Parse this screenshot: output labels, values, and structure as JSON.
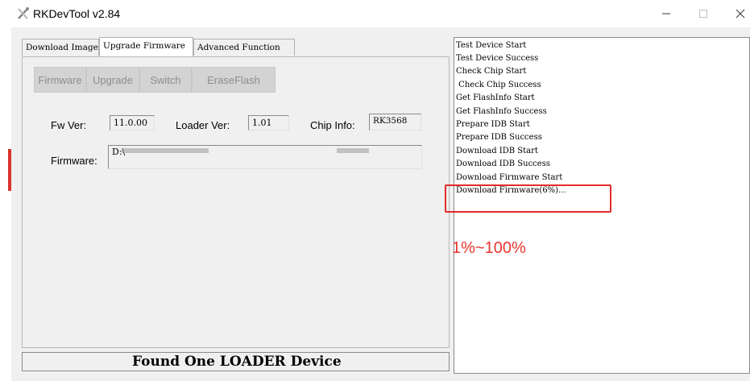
{
  "window": {
    "title": "RKDevTool v2.84"
  },
  "tabs": [
    {
      "label": "Download Image"
    },
    {
      "label": "Upgrade Firmware"
    },
    {
      "label": "Advanced Function"
    }
  ],
  "toolbar": {
    "firmware": "Firmware",
    "upgrade": "Upgrade",
    "switch": "Switch",
    "erase": "EraseFlash"
  },
  "info": {
    "fw_ver_label": "Fw Ver:",
    "fw_ver_value": "11.0.00",
    "loader_ver_label": "Loader Ver:",
    "loader_ver_value": "1.01",
    "chip_info_label": "Chip Info:",
    "chip_info_value": "RK3568",
    "firmware_label": "Firmware:",
    "firmware_path": "D:\\"
  },
  "status": {
    "text": "Found One LOADER Device"
  },
  "log": {
    "lines": [
      "Test Device Start",
      "Test Device Success",
      "Check Chip Start",
      " Check Chip Success",
      "Get FlashInfo Start",
      "Get FlashInfo Success",
      "Prepare IDB Start",
      "Prepare IDB Success",
      "Download IDB Start",
      "Download IDB Success",
      "Download Firmware Start",
      "Download Firmware(6%)..."
    ]
  },
  "annotation": {
    "text": "1%~100%"
  },
  "colors": {
    "highlight": "#e22b2b",
    "annotation": "#e8352e"
  }
}
